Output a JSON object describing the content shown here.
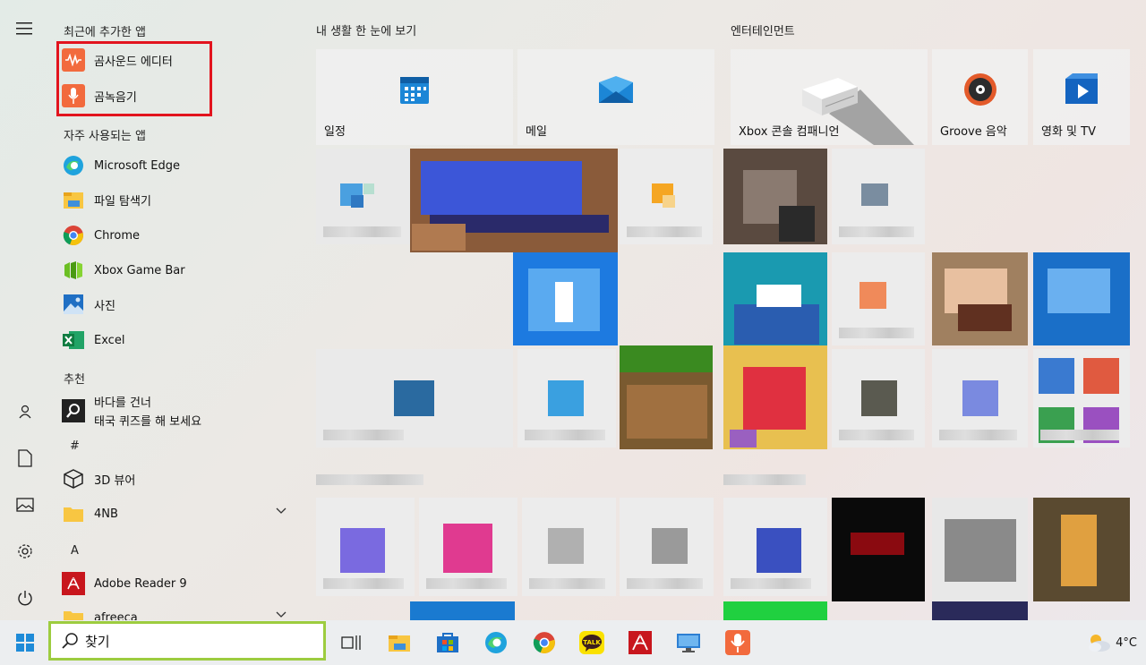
{
  "app_list": {
    "recent_header": "최근에 추가한 앱",
    "recent": [
      {
        "label": "곰사운드 에디터",
        "icon": "gom-sound-editor-icon"
      },
      {
        "label": "곰녹음기",
        "icon": "gom-recorder-icon"
      }
    ],
    "frequent_header": "자주 사용되는 앱",
    "frequent": [
      {
        "label": "Microsoft Edge",
        "icon": "edge-icon"
      },
      {
        "label": "파일 탐색기",
        "icon": "file-explorer-icon"
      },
      {
        "label": "Chrome",
        "icon": "chrome-icon"
      },
      {
        "label": "Xbox Game Bar",
        "icon": "xbox-game-bar-icon"
      },
      {
        "label": "사진",
        "icon": "photos-icon"
      },
      {
        "label": "Excel",
        "icon": "excel-icon"
      }
    ],
    "suggested_header": "추천",
    "suggested_line1": "바다를 건너",
    "suggested_line2": "태국 퀴즈를 해 보세요",
    "hash_header": "#",
    "apps_hash": [
      {
        "label": "3D 뷰어",
        "icon": "3d-viewer-icon"
      },
      {
        "label": "4NB",
        "icon": "folder-icon"
      }
    ],
    "a_header": "A",
    "apps_a": [
      {
        "label": "Adobe Reader 9",
        "icon": "adobe-reader-icon"
      },
      {
        "label": "afreeca",
        "icon": "folder-icon"
      }
    ]
  },
  "tiles": {
    "group1_header": "내 생활 한 눈에 보기",
    "group2_header": "엔터테인먼트",
    "calendar_label": "일정",
    "mail_label": "메일",
    "xbox_label": "Xbox 콘솔 컴패니언",
    "groove_label": "Groove 음악",
    "movies_label": "영화 및 TV"
  },
  "taskbar": {
    "search_text": "찾기",
    "weather_temp": "4°C",
    "pinned_icons": [
      "task-view-icon",
      "file-explorer-icon",
      "microsoft-store-icon",
      "edge-icon",
      "chrome-icon",
      "kakaotalk-icon",
      "adobe-reader-icon",
      "remote-desktop-icon",
      "gom-recorder-icon"
    ],
    "kakaotalk_text": "TALK"
  },
  "colors": {
    "highlight": "#e2141e",
    "search_border": "#9dcc3f",
    "accent_blue": "#0078d4"
  }
}
